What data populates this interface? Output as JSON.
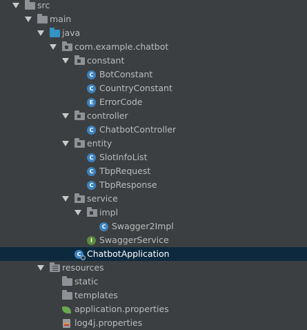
{
  "tree": {
    "src": "src",
    "main": "main",
    "java": "java",
    "package": "com.example.chatbot",
    "constant": "constant",
    "BotConstant": "BotConstant",
    "CountryConstant": "CountryConstant",
    "ErrorCode": "ErrorCode",
    "controller": "controller",
    "ChatbotController": "ChatbotController",
    "entity": "entity",
    "SlotInfoList": "SlotInfoList",
    "TbpRequest": "TbpRequest",
    "TbpResponse": "TbpResponse",
    "service": "service",
    "impl": "impl",
    "Swagger2Impl": "Swagger2Impl",
    "SwaggerService": "SwaggerService",
    "ChatbotApplication": "ChatbotApplication",
    "resources": "resources",
    "static": "static",
    "templates": "templates",
    "application_properties": "application.properties",
    "log4j_properties": "log4j.properties"
  },
  "badges": {
    "class": "C",
    "enum": "E",
    "interface": "I"
  },
  "colors": {
    "background": "#3c3f41",
    "selection": "#0d293e",
    "text": "#bbbbbb",
    "class_badge": "#3c83c0",
    "interface_badge": "#5b8c3a",
    "source_folder": "#3592c4"
  }
}
